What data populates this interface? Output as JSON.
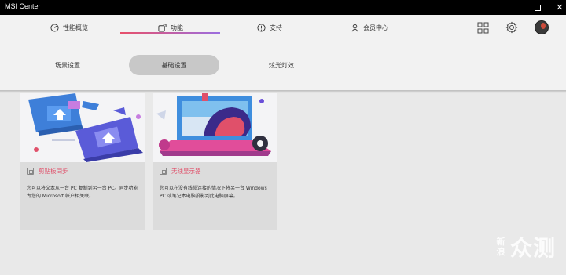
{
  "window": {
    "title": "MSI Center",
    "minimize_glyph": "—",
    "maximize_glyph": "□",
    "close_glyph": "✕"
  },
  "nav": {
    "tabs": [
      {
        "label": "性能概览",
        "icon": "gauge-icon"
      },
      {
        "label": "功能",
        "icon": "feature-icon"
      },
      {
        "label": "支持",
        "icon": "support-icon"
      },
      {
        "label": "会员中心",
        "icon": "user-icon"
      }
    ],
    "active_index": 1,
    "right_icons": [
      "grid-icon",
      "gear-icon",
      "avatar"
    ]
  },
  "subtabs": {
    "items": [
      "场景设置",
      "基础设置",
      "炫光灯效"
    ],
    "active_index": 1
  },
  "cards": [
    {
      "title": "剪贴板同步",
      "icon": "feature-card-icon",
      "description": "您可以将文本从一台 PC 复制到另一台 PC。同步功能专您的 Microsoft 帐户相关联。"
    },
    {
      "title": "无线显示器",
      "icon": "feature-card-icon",
      "description": "您可以在没有线缆连接的情况下将另一台 Windows PC 或笔记本电脑投影到此电脑屏幕。"
    }
  ],
  "watermark": {
    "small": "新浪",
    "big": "众测"
  },
  "colors": {
    "accent_gradient_start": "#e8506a",
    "accent_gradient_end": "#9b6ee0",
    "feature_title": "#e0506a",
    "titlebar": "#000000"
  }
}
